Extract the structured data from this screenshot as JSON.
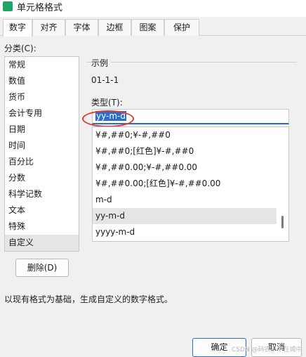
{
  "window": {
    "title": "单元格格式"
  },
  "tabs": [
    {
      "label": "数字",
      "active": true
    },
    {
      "label": "对齐",
      "active": false
    },
    {
      "label": "字体",
      "active": false
    },
    {
      "label": "边框",
      "active": false
    },
    {
      "label": "图案",
      "active": false
    },
    {
      "label": "保护",
      "active": false
    }
  ],
  "category": {
    "label": "分类(C):",
    "items": [
      "常规",
      "数值",
      "货币",
      "会计专用",
      "日期",
      "时间",
      "百分比",
      "分数",
      "科学记数",
      "文本",
      "特殊",
      "自定义"
    ],
    "selected": "自定义"
  },
  "delete_button": "删除(D)",
  "sample": {
    "label": "示例",
    "value": "01-1-1"
  },
  "type": {
    "label": "类型(T):",
    "value": "yy-m-d",
    "options": [
      "¥#,##0;¥-#,##0",
      "¥#,##0;[红色]¥-#,##0",
      "¥#,##0.00;¥-#,##0.00",
      "¥#,##0.00;[红色]¥-#,##0.00",
      "m-d",
      "yy-m-d",
      "yyyy-m-d"
    ],
    "selected": "yy-m-d"
  },
  "description": "以现有格式为基础，生成自定义的数字格式。",
  "ok_button": "确定",
  "cancel_button": "取消",
  "watermark": "CSDN @码农小牛在城中",
  "colors": {
    "accent": "#2c6dc8",
    "annotation": "#e03a2e",
    "app_icon": "#1fa463"
  }
}
